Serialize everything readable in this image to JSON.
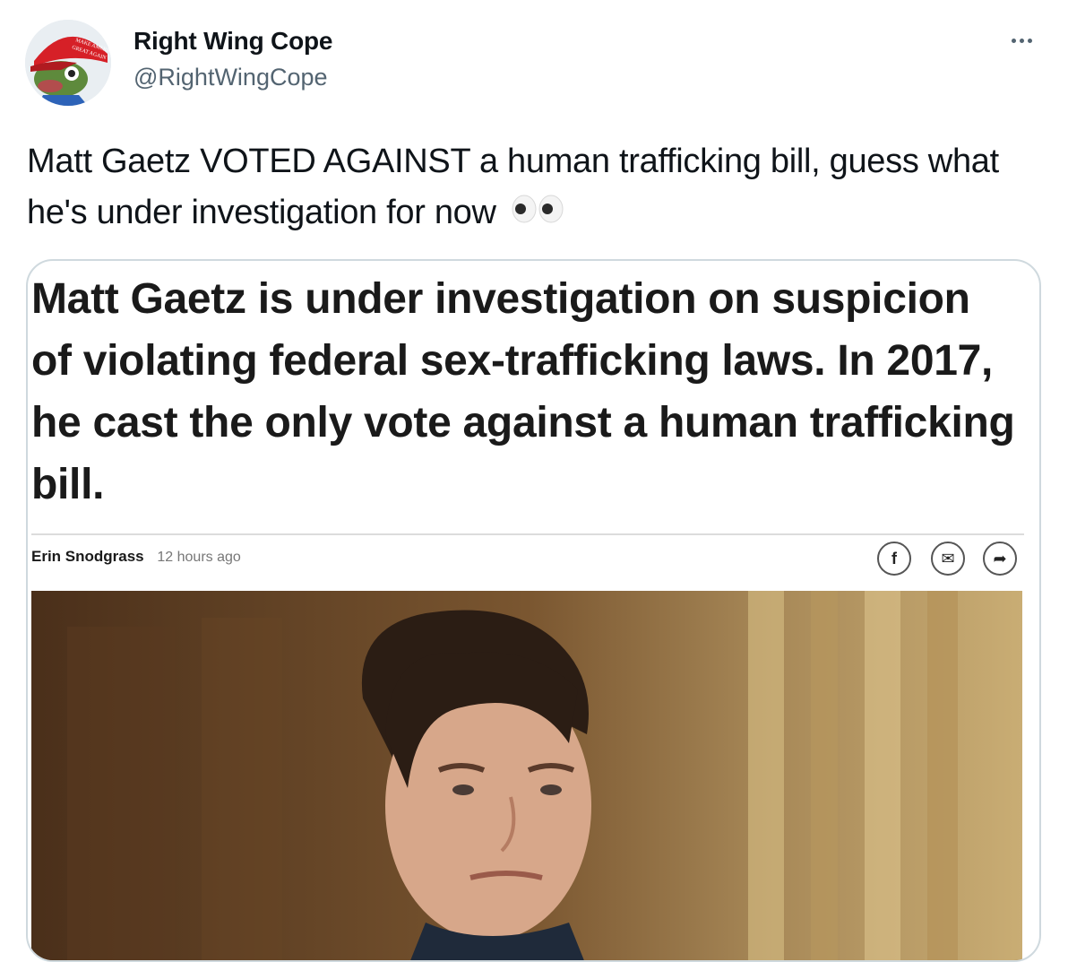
{
  "author": {
    "display_name": "Right Wing Cope",
    "handle": "@RightWingCope",
    "avatar_icon": "frog-in-red-cap-avatar",
    "avatar_cap_text": "MAKE AMERICA GREAT AGAIN"
  },
  "tweet": {
    "text": "Matt Gaetz VOTED AGAINST a human trafficking bill, guess what he's under investigation for now",
    "emoji_icon": "eyes-icon"
  },
  "more_icon": "more-dots-icon",
  "media": {
    "headline": "Matt Gaetz is under investigation on suspicion of violating federal sex-trafficking laws. In 2017, he cast the only vote against a human trafficking bill.",
    "author": "Erin Snodgrass",
    "time": "12 hours ago",
    "share_buttons": [
      {
        "icon": "facebook-icon",
        "glyph": "f"
      },
      {
        "icon": "email-icon",
        "glyph": "✉"
      },
      {
        "icon": "share-arrow-icon",
        "glyph": "➦"
      }
    ]
  },
  "colors": {
    "text_primary": "#0f1419",
    "text_secondary": "#536471",
    "border": "#cfd9de"
  }
}
